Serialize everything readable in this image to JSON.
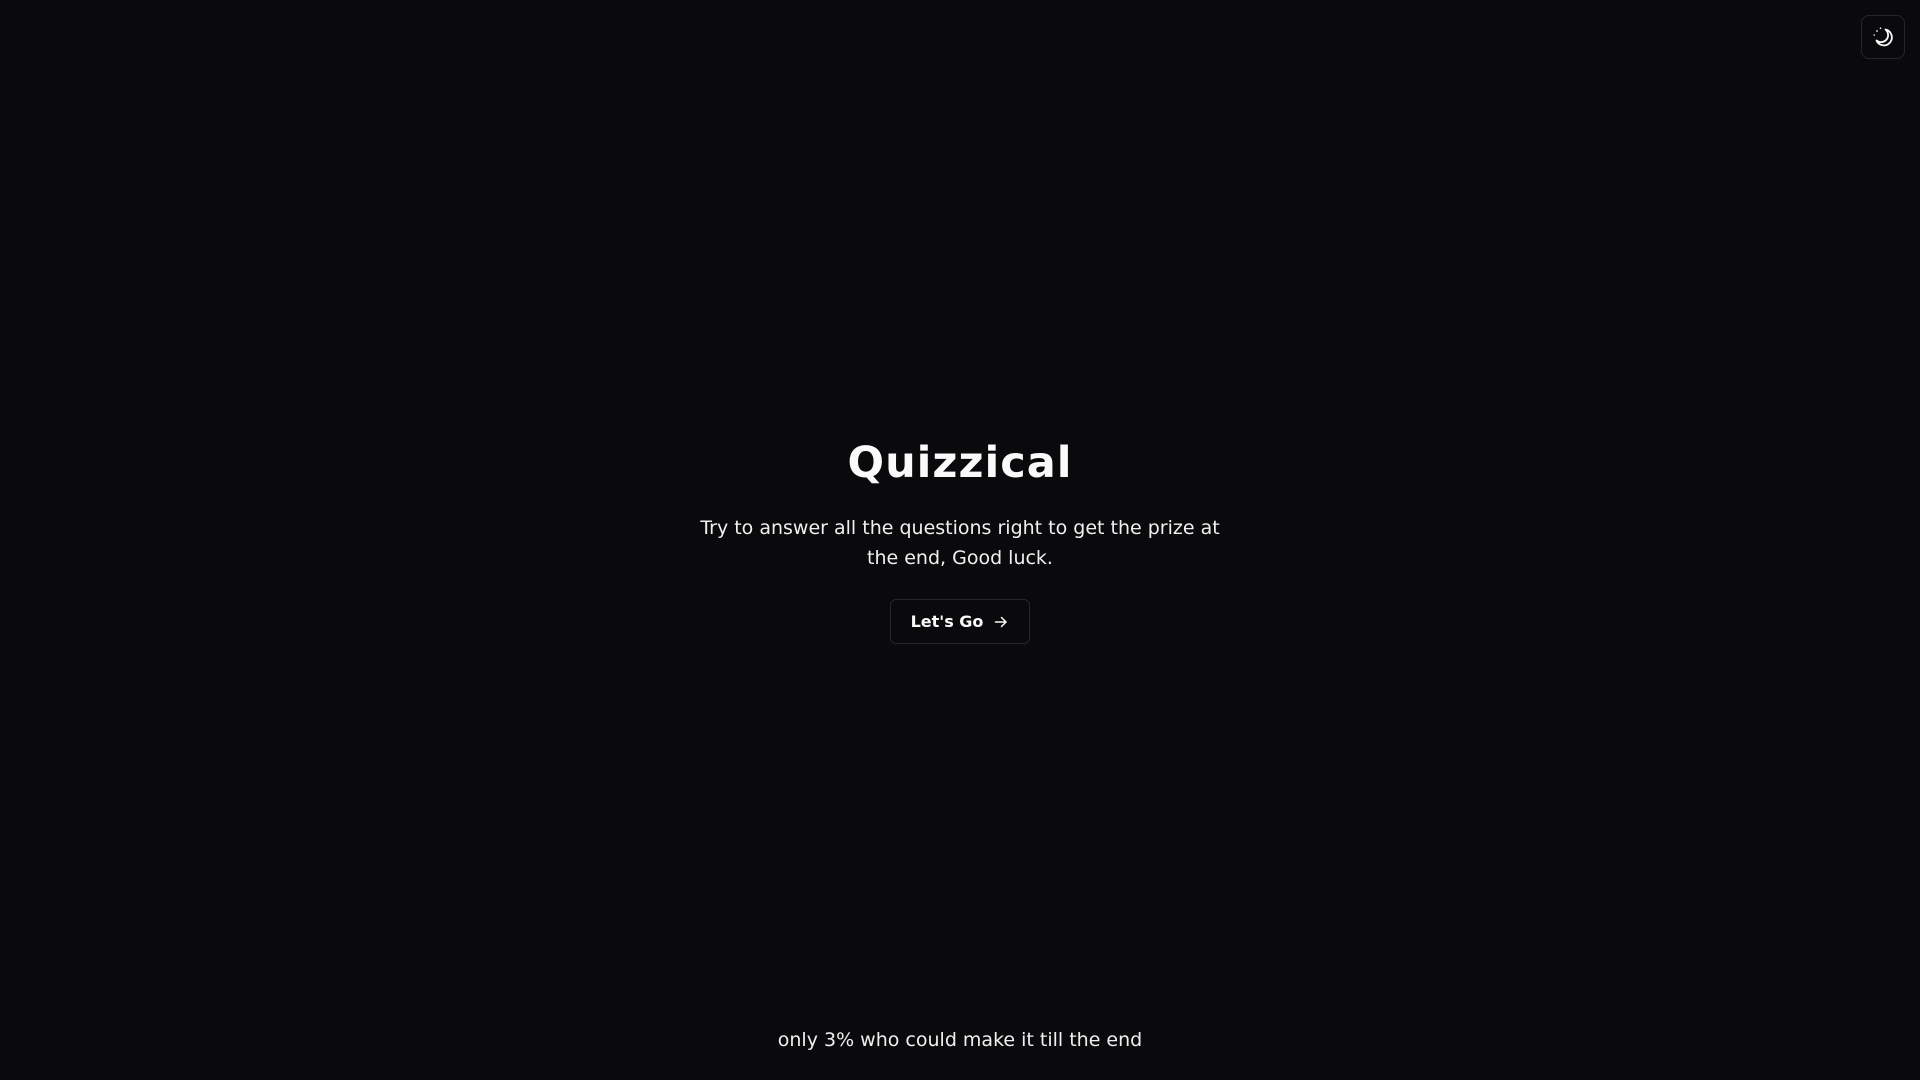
{
  "theme_toggle": {
    "icon": "moon-stars-icon"
  },
  "hero": {
    "title": "Quizzical",
    "subtitle": "Try to answer all the questions right to get the prize at the end, Good luck.",
    "start_button": {
      "label": "Let's Go",
      "icon": "arrow-right-icon"
    }
  },
  "footer": {
    "note": "only 3% who could make it till the end"
  },
  "colors": {
    "background": "#0a0a0c",
    "text": "#fafafa",
    "border": "#27272a"
  }
}
